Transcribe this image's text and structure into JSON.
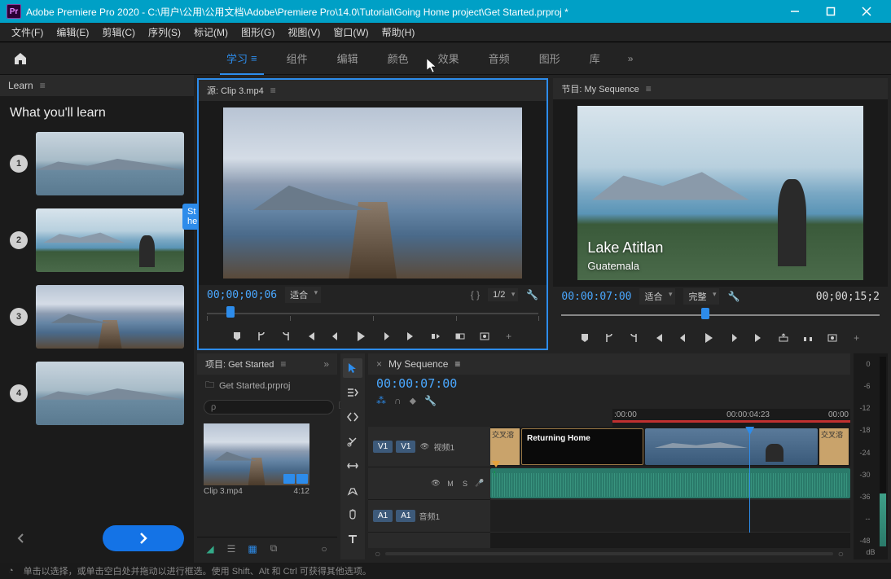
{
  "titlebar": {
    "title": "Adobe Premiere Pro 2020 - C:\\用户\\公用\\公用文档\\Adobe\\Premiere Pro\\14.0\\Tutorial\\Going Home project\\Get Started.prproj *"
  },
  "menu": {
    "items": [
      "文件(F)",
      "编辑(E)",
      "剪辑(C)",
      "序列(S)",
      "标记(M)",
      "图形(G)",
      "视图(V)",
      "窗口(W)",
      "帮助(H)"
    ]
  },
  "workspaces": {
    "items": [
      "学习",
      "组件",
      "编辑",
      "颜色",
      "效果",
      "音频",
      "图形",
      "库"
    ],
    "active": 0
  },
  "learn": {
    "tab": "Learn",
    "heading": "What you'll learn",
    "lessons": [
      "1",
      "2",
      "3",
      "4"
    ],
    "coach_label": "St\nhe"
  },
  "source": {
    "panel_title": "源: Clip 3.mp4",
    "timecode": "00;00;00;06",
    "zoom": "适合",
    "resolution": "1/2"
  },
  "program": {
    "panel_title": "节目: My Sequence",
    "timecode": "00:00:07:00",
    "zoom": "适合",
    "quality": "完整",
    "duration": "00;00;15;2",
    "overlay_title": "Lake Atitlan",
    "overlay_sub": "Guatemala"
  },
  "project": {
    "panel_title": "项目: Get Started",
    "filename": "Get Started.prproj",
    "search_placeholder": "ρ",
    "clip_name": "Clip 3.mp4",
    "clip_duration": "4:12"
  },
  "timeline": {
    "panel_title": "My Sequence",
    "timecode": "00:00:07:00",
    "ruler": [
      ":00:00",
      "00:00:04:23",
      "00:00"
    ],
    "v1_label": "V1",
    "v1_name": "视频1",
    "a1_label": "A1",
    "a1_name": "音频1",
    "mute": "M",
    "solo": "S",
    "title_clip": "Returning Home",
    "wedge_label": "交叉溶"
  },
  "meters": {
    "scale": [
      "0",
      "-6",
      "-12",
      "-18",
      "-24",
      "-30",
      "-36",
      "--",
      "-48"
    ],
    "unit": "dB"
  },
  "status": {
    "hint": "单击以选择，或单击空白处并拖动以进行框选。使用 Shift、Alt 和 Ctrl 可获得其他选项。"
  }
}
